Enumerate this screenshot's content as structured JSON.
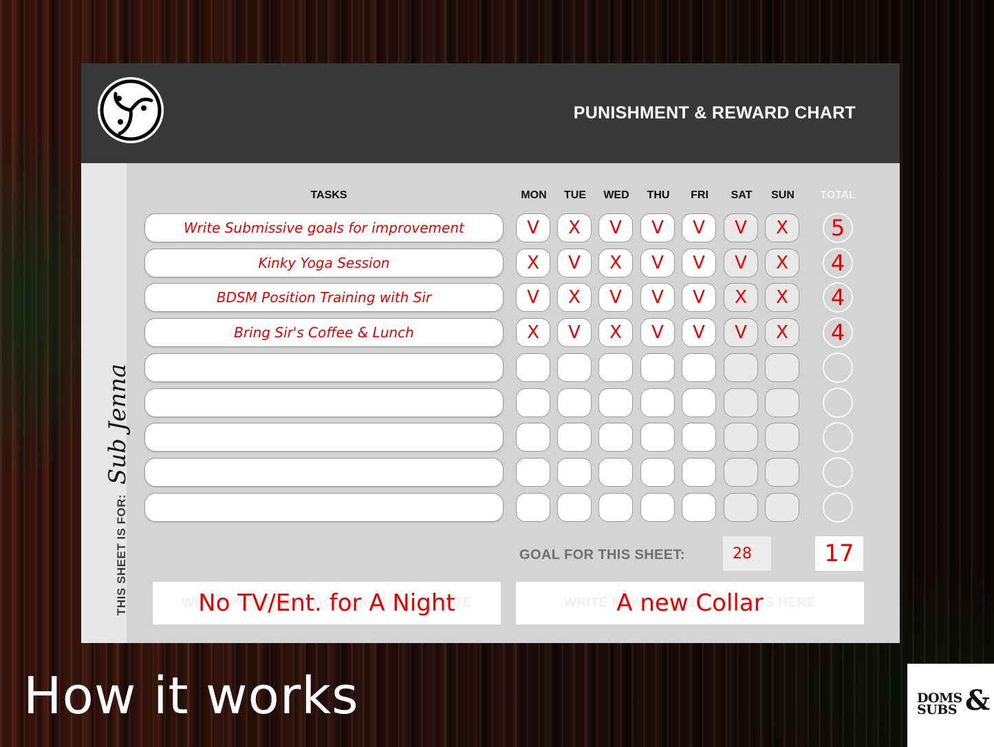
{
  "header": {
    "title": "PUNISHMENT & REWARD CHART",
    "logo_icon": "bdsm-triskelion-icon"
  },
  "sheet_for": {
    "label": "THIS SHEET IS FOR:",
    "value": "Sub Jenna"
  },
  "columns": {
    "tasks": "TASKS",
    "days": [
      "MON",
      "TUE",
      "WED",
      "THU",
      "FRI",
      "SAT",
      "SUN"
    ],
    "total": "TOTAL"
  },
  "rows": [
    {
      "task": "Write Submissive goals for improvement",
      "marks": [
        "V",
        "X",
        "V",
        "V",
        "V",
        "V",
        "X"
      ],
      "total": "5"
    },
    {
      "task": "Kinky Yoga Session",
      "marks": [
        "X",
        "V",
        "X",
        "V",
        "V",
        "V",
        "X"
      ],
      "total": "4"
    },
    {
      "task": "BDSM Position Training with Sir",
      "marks": [
        "V",
        "X",
        "V",
        "V",
        "V",
        "X",
        "X"
      ],
      "total": "4"
    },
    {
      "task": "Bring Sir's Coffee & Lunch",
      "marks": [
        "X",
        "V",
        "X",
        "V",
        "V",
        "V",
        "X"
      ],
      "total": "4"
    },
    {
      "task": "",
      "marks": [
        "",
        "",
        "",
        "",
        "",
        "",
        ""
      ],
      "total": ""
    },
    {
      "task": "",
      "marks": [
        "",
        "",
        "",
        "",
        "",
        "",
        ""
      ],
      "total": ""
    },
    {
      "task": "",
      "marks": [
        "",
        "",
        "",
        "",
        "",
        "",
        ""
      ],
      "total": ""
    },
    {
      "task": "",
      "marks": [
        "",
        "",
        "",
        "",
        "",
        "",
        ""
      ],
      "total": ""
    },
    {
      "task": "",
      "marks": [
        "",
        "",
        "",
        "",
        "",
        "",
        ""
      ],
      "total": ""
    }
  ],
  "goal": {
    "label": "GOAL FOR THIS SHEET:",
    "value": "28",
    "achieved": "17"
  },
  "punishment": {
    "placeholder": "WRITE PUNISHMENT/CONSEQUENCE HERE",
    "value": "No TV/Ent. for A Night"
  },
  "reward": {
    "placeholder": "WRITE REWARD FOR SUCCESS HERE",
    "value": "A new Collar"
  },
  "caption": "How it works",
  "brand": {
    "line1": "DOMS",
    "line2": "SUBS",
    "ampersand": "&"
  }
}
